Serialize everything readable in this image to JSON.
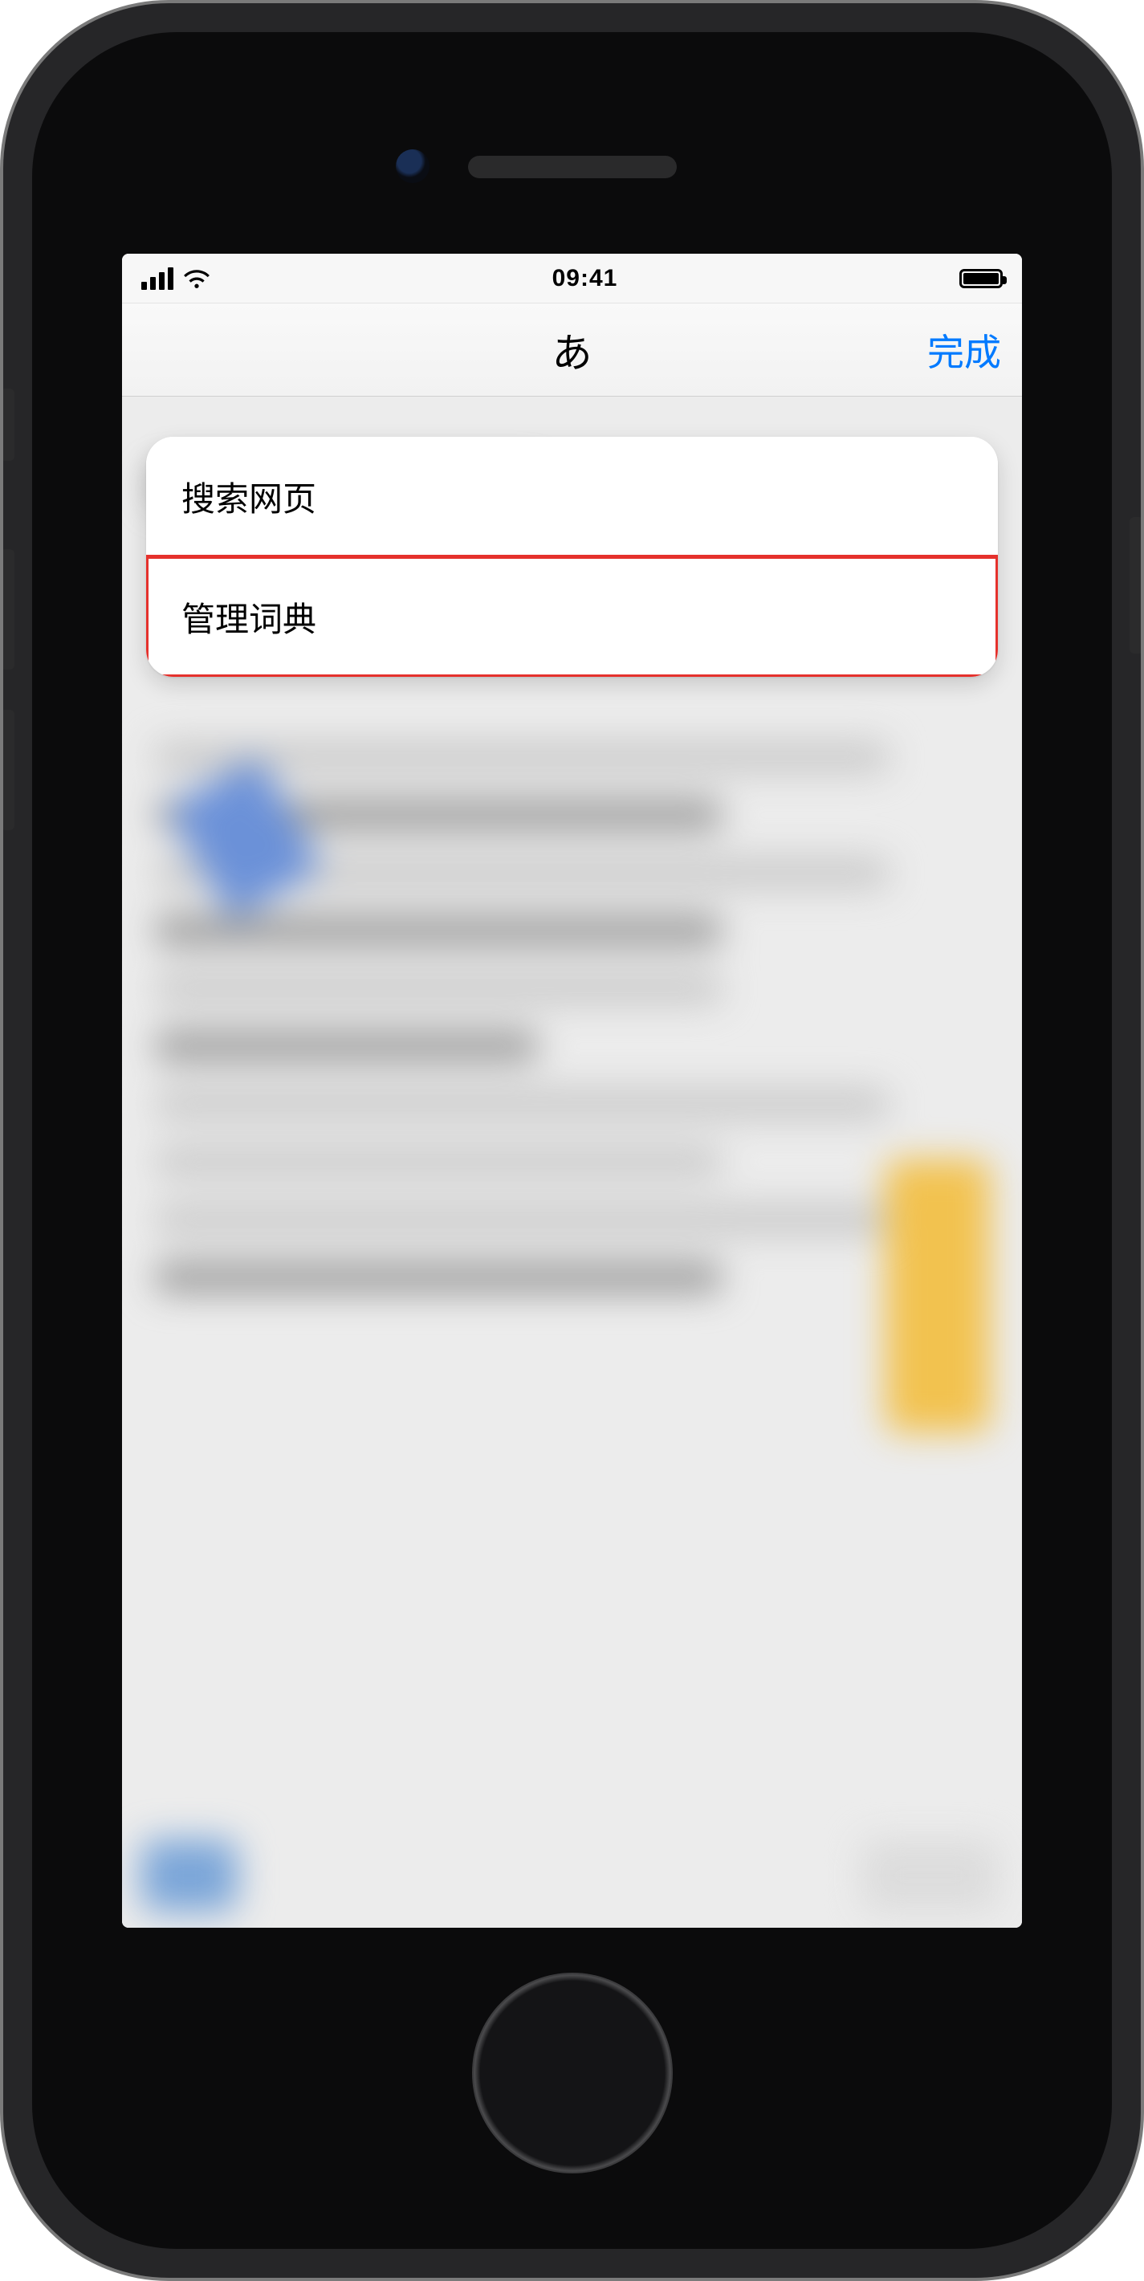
{
  "status_bar": {
    "time": "09:41"
  },
  "nav": {
    "title": "あ",
    "done": "完成"
  },
  "actions": {
    "search_web": "搜索网页",
    "manage_dictionaries": "管理词典"
  }
}
